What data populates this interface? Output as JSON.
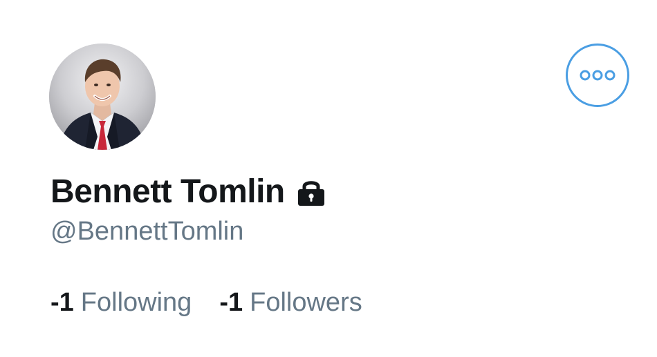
{
  "profile": {
    "display_name": "Bennett Tomlin",
    "handle": "@BennettTomlin",
    "protected_icon": "lock-icon",
    "avatar_icon": "profile-photo"
  },
  "more_button": {
    "icon": "more-horizontal-icon",
    "accent_color": "#4a9ee3"
  },
  "stats": {
    "following": {
      "count": "-1",
      "label": "Following"
    },
    "followers": {
      "count": "-1",
      "label": "Followers"
    }
  },
  "colors": {
    "name": "#14171a",
    "secondary": "#657786",
    "accent": "#4a9ee3"
  }
}
